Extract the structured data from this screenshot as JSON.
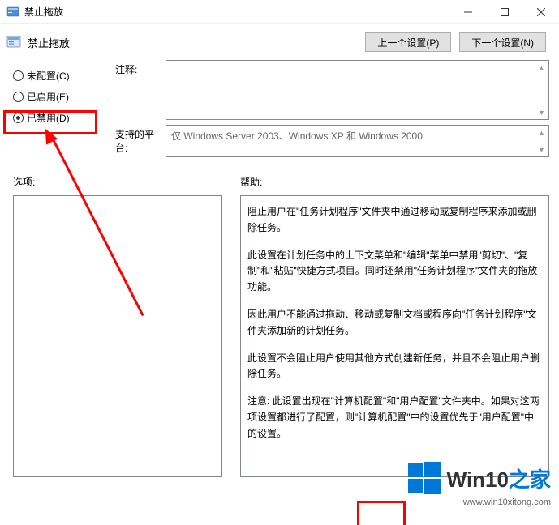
{
  "titlebar": {
    "title": "禁止拖放"
  },
  "header": {
    "title": "禁止拖放",
    "prev_btn": "上一个设置(P)",
    "next_btn": "下一个设置(N)"
  },
  "radios": {
    "not_configured": "未配置(C)",
    "enabled": "已启用(E)",
    "disabled": "已禁用(D)",
    "selected": "disabled"
  },
  "fields": {
    "comment_label": "注释:",
    "platform_label": "支持的平台:",
    "platform_value": "仅 Windows Server 2003、Windows XP 和 Windows 2000"
  },
  "lower": {
    "options_label": "选项:",
    "help_label": "帮助:",
    "help_paragraphs": [
      "阻止用户在\"任务计划程序\"文件夹中通过移动或复制程序来添加或删除任务。",
      "此设置在计划任务中的上下文菜单和\"编辑\"菜单中禁用\"剪切\"、\"复制\"和\"粘贴\"快捷方式项目。同时还禁用\"任务计划程序\"文件夹的拖放功能。",
      "因此用户不能通过拖动、移动或复制文档或程序向\"任务计划程序\"文件夹添加新的计划任务。",
      "此设置不会阻止用户使用其他方式创建新任务，并且不会阻止用户删除任务。",
      "注意: 此设置出现在\"计算机配置\"和\"用户配置\"文件夹中。如果对这两项设置都进行了配置，则\"计算机配置\"中的设置优先于\"用户配置\"中的设置。"
    ]
  },
  "watermark": {
    "brand": "Win10",
    "suffix": "之家",
    "url": "www.win10xitong.com"
  }
}
